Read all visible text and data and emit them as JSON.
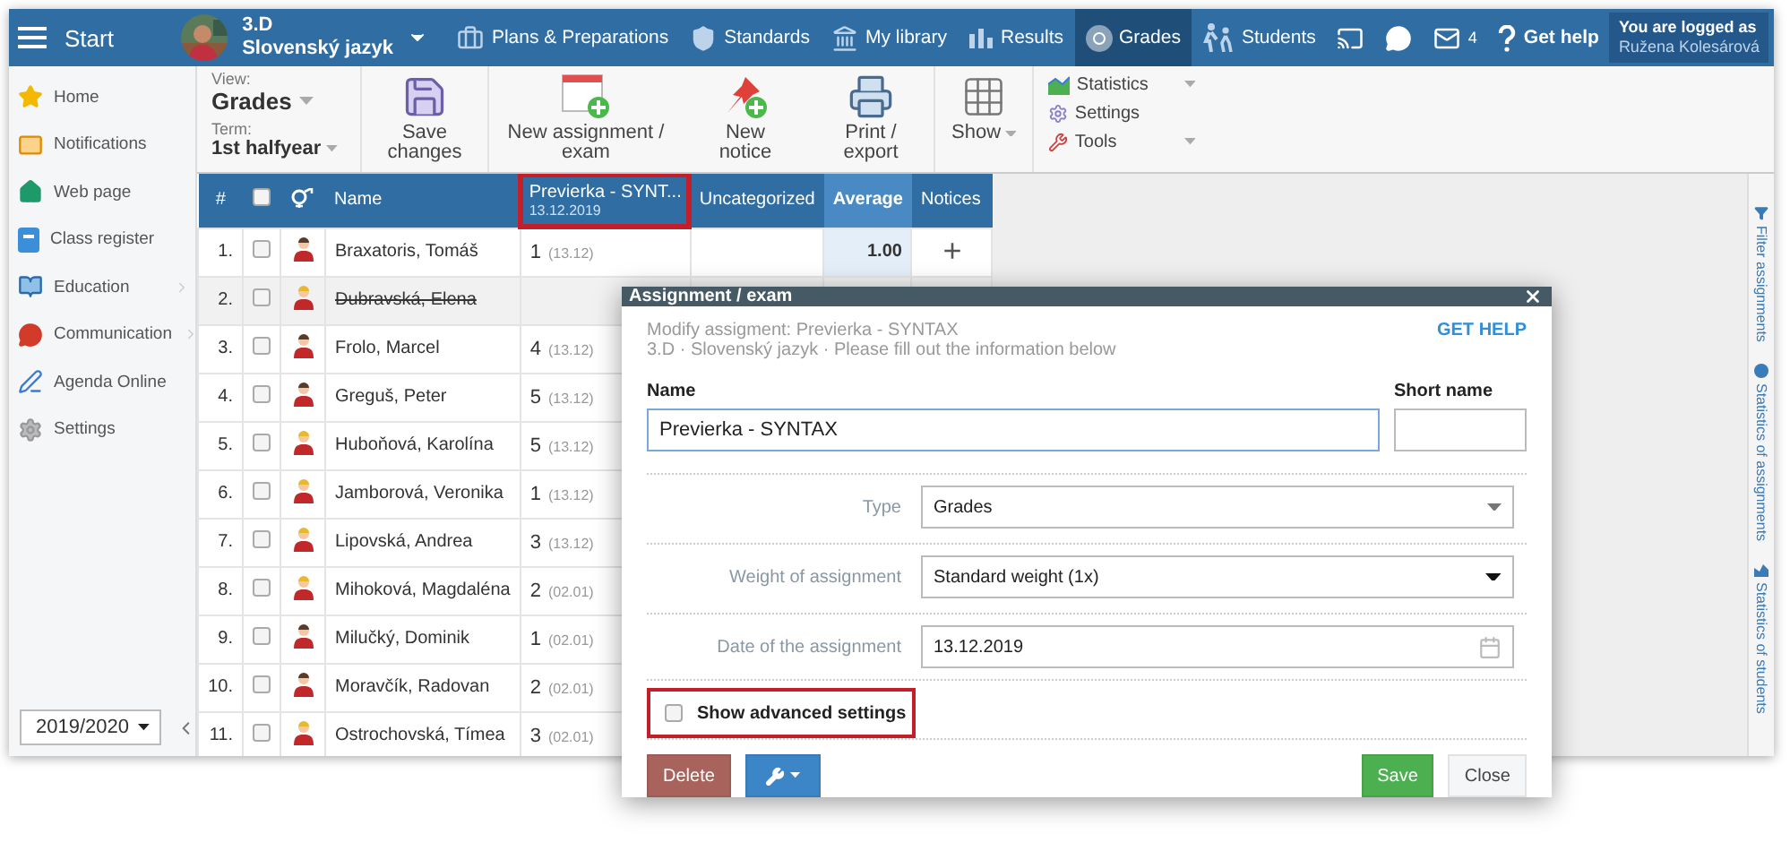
{
  "topbar": {
    "start": "Start",
    "class_name": "3.D",
    "subject": "Slovenský jazyk",
    "items": [
      {
        "kind": "briefcase",
        "label": "Plans & Preparations",
        "selected": false
      },
      {
        "kind": "shield",
        "label": "Standards",
        "selected": false
      },
      {
        "kind": "library",
        "label": "My library",
        "selected": false
      },
      {
        "kind": "chart",
        "label": "Results",
        "selected": false
      },
      {
        "kind": "grades",
        "label": "Grades",
        "selected": true
      },
      {
        "kind": "students",
        "label": "Students",
        "selected": false
      },
      {
        "kind": "cast",
        "selected": false
      },
      {
        "kind": "chat",
        "selected": false
      },
      {
        "kind": "mail",
        "label": "4",
        "selected": false
      },
      {
        "kind": "help",
        "label": "Get help",
        "selected": false
      }
    ],
    "login": {
      "caption": "You are logged as",
      "user": "Ružena Kolesárová"
    }
  },
  "sidebar": {
    "items": [
      {
        "kind": "star",
        "label": "Home",
        "expandable": false
      },
      {
        "kind": "mail",
        "label": "Notifications",
        "expandable": false
      },
      {
        "kind": "house",
        "label": "Web page",
        "expandable": false
      },
      {
        "kind": "book",
        "label": "Class register",
        "expandable": false
      },
      {
        "kind": "education",
        "label": "Education",
        "expandable": true
      },
      {
        "kind": "chat",
        "label": "Communication",
        "expandable": true
      },
      {
        "kind": "pen",
        "label": "Agenda Online",
        "expandable": false
      },
      {
        "kind": "gear",
        "label": "Settings",
        "expandable": false
      }
    ],
    "year": "2019/2020"
  },
  "toolbar": {
    "view_label": "View:",
    "view": "Grades",
    "term_label": "Term:",
    "term": "1st halfyear",
    "buttons": [
      {
        "kind": "save",
        "label": "Save changes"
      },
      {
        "kind": "new-assignment",
        "label": "New assignment / exam"
      },
      {
        "kind": "new-notice",
        "label": "New notice"
      },
      {
        "kind": "print",
        "label": "Print / export"
      },
      {
        "kind": "show",
        "label": "Show"
      }
    ],
    "menu": [
      {
        "kind": "statistics",
        "label": "Statistics",
        "dropdown": true
      },
      {
        "kind": "settings",
        "label": "Settings",
        "dropdown": false
      },
      {
        "kind": "tools",
        "label": "Tools",
        "dropdown": true
      }
    ]
  },
  "right_panel": [
    "Filter assignments",
    "Statistics of assignments",
    "Statistics of students"
  ],
  "table": {
    "select_all_checked": false,
    "columns": [
      {
        "label": "#"
      },
      {
        "label": "Name"
      },
      {
        "label": "Previerka - SYNT...",
        "date": "13.12.2019",
        "highlighted": true
      },
      {
        "label": "Uncategorized"
      },
      {
        "label": "Average"
      },
      {
        "label": "Notices"
      }
    ],
    "rows": [
      {
        "number": "1.",
        "checked": false,
        "kind": "male",
        "name": "Braxatoris, Tomáš",
        "withdrawn": false,
        "grade": "1",
        "grade_date": "(13.12)",
        "average": "1.00",
        "notice": "+"
      },
      {
        "number": "2.",
        "checked": false,
        "kind": "female",
        "name": "Dubravská, Elena",
        "withdrawn": true
      },
      {
        "number": "3.",
        "checked": false,
        "kind": "male",
        "name": "Frolo, Marcel",
        "withdrawn": false,
        "grade": "4",
        "grade_date": "(13.12)"
      },
      {
        "number": "4.",
        "checked": false,
        "kind": "male",
        "name": "Greguš, Peter",
        "withdrawn": false,
        "grade": "5",
        "grade_date": "(13.12)"
      },
      {
        "number": "5.",
        "checked": false,
        "kind": "female",
        "name": "Huboňová, Karolína",
        "withdrawn": false,
        "grade": "5",
        "grade_date": "(13.12)"
      },
      {
        "number": "6.",
        "checked": false,
        "kind": "female",
        "name": "Jamborová, Veronika",
        "withdrawn": false,
        "grade": "1",
        "grade_date": "(13.12)"
      },
      {
        "number": "7.",
        "checked": false,
        "kind": "female",
        "name": "Lipovská, Andrea",
        "withdrawn": false,
        "grade": "3",
        "grade_date": "(13.12)"
      },
      {
        "number": "8.",
        "checked": false,
        "kind": "female",
        "name": "Mihoková, Magdaléna",
        "withdrawn": false,
        "grade": "2",
        "grade_date": "(02.01)"
      },
      {
        "number": "9.",
        "checked": false,
        "kind": "male",
        "name": "Milučký, Dominik",
        "withdrawn": false,
        "grade": "1",
        "grade_date": "(02.01)"
      },
      {
        "number": "10.",
        "checked": false,
        "kind": "male",
        "name": "Moravčík, Radovan",
        "withdrawn": false,
        "grade": "2",
        "grade_date": "(02.01)"
      },
      {
        "number": "11.",
        "checked": false,
        "kind": "female",
        "name": "Ostrochovská, Tímea",
        "withdrawn": false,
        "grade": "3",
        "grade_date": "(02.01)"
      }
    ]
  },
  "dialog": {
    "title": "Assignment / exam",
    "subtitle": "Modify assigment: Previerka - SYNTAX",
    "context": "3.D · Slovenský jazyk · Please fill out the information below",
    "help": "GET HELP",
    "name_label": "Name",
    "name_value": "Previerka - SYNTAX",
    "short_label": "Short name",
    "fields": [
      {
        "kind": "select",
        "label": "Type",
        "value": "Grades"
      },
      {
        "kind": "native-select",
        "label": "Weight of assignment",
        "value": "Standard weight (1x)"
      },
      {
        "kind": "date",
        "label": "Date of the assignment",
        "value": "13.12.2019"
      }
    ],
    "advanced": {
      "label": "Show advanced settings",
      "checked": false,
      "highlighted": true
    },
    "buttons": {
      "delete": "Delete",
      "save": "Save",
      "close": "Close"
    }
  }
}
